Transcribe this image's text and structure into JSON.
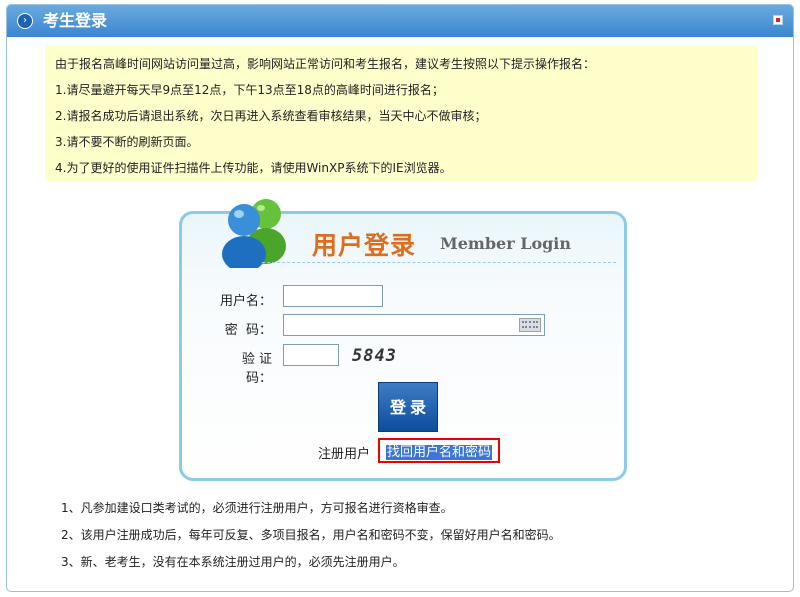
{
  "header": {
    "title": "考生登录"
  },
  "notice": {
    "lines": [
      "由于报名高峰时间网站访问量过高，影响网站正常访问和考生报名，建议考生按照以下提示操作报名：",
      "1.请尽量避开每天早9点至12点，下午13点至18点的高峰时间进行报名；",
      "2.请报名成功后请退出系统，次日再进入系统查看审核结果，当天中心不做审核；",
      "3.请不要不断的刷新页面。",
      "4.为了更好的使用证件扫描件上传功能，请使用WinXP系统下的IE浏览器。"
    ]
  },
  "login": {
    "title_cn": "用户登录",
    "title_en": "Member Login",
    "username_label": "用户名：",
    "password_label": "密  码：",
    "captcha_label": "验 证 码：",
    "username_value": "",
    "password_value": "",
    "captcha_value": "",
    "captcha_image_text": "5843",
    "submit_label": "登录",
    "register_link": "注册用户",
    "find_link": "找回用户名和密码"
  },
  "footer": {
    "notes": [
      "1、凡参加建设口类考试的，必须进行注册用户，方可报名进行资格审查。",
      "2、该用户注册成功后，每年可反复、多项目报名，用户名和密码不变，保留好用户名和密码。",
      "3、新、老考生，没有在本系统注册过用户的，必须先注册用户。"
    ]
  },
  "colors": {
    "titlebar": "#3c86cf",
    "notice_bg": "#ffffcc",
    "login_border": "#8ccbe6",
    "login_title": "#e06d1c",
    "button": "#0e4d9a",
    "highlight_border": "#e00000"
  }
}
